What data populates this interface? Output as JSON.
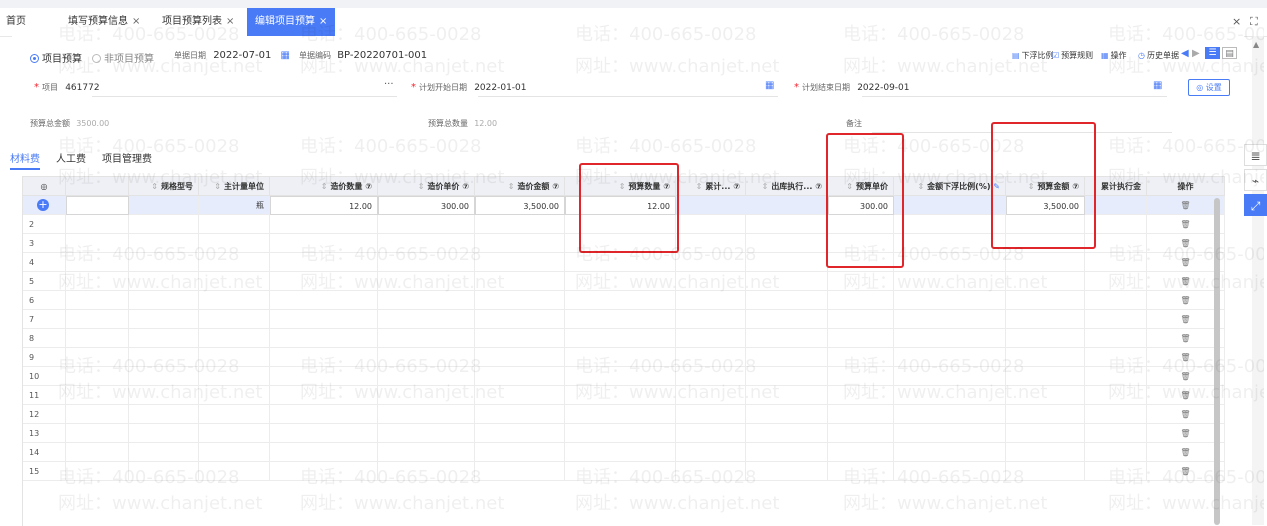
{
  "tabs": [
    {
      "label": "首页",
      "closable": false,
      "active": false
    },
    {
      "label": "填写预算信息",
      "closable": true,
      "active": false
    },
    {
      "label": "项目预算列表",
      "closable": true,
      "active": false
    },
    {
      "label": "编辑项目预算",
      "closable": true,
      "active": true
    }
  ],
  "tab_close_symbol": "×",
  "window_controls": {
    "close": "×",
    "expand": "⛶"
  },
  "header": {
    "radio_project": "项目预算",
    "radio_nonproject": "非项目预算",
    "doc_date_label": "单据日期",
    "doc_date_value": "2022-07-01",
    "doc_code_label": "单据编码",
    "doc_code_value": "BP-20220701-001"
  },
  "toolbar": [
    {
      "label": "下浮比例",
      "icon": "percent-icon"
    },
    {
      "label": "预算规则",
      "icon": "rule-icon"
    },
    {
      "label": "操作",
      "icon": "grid-icon"
    },
    {
      "label": "历史单据",
      "icon": "history-icon"
    }
  ],
  "form": {
    "project_label": "项目",
    "project_value": "461772",
    "project_more": "···",
    "start_label": "计划开始日期",
    "start_value": "2022-01-01",
    "end_label": "计划结束日期",
    "end_value": "2022-09-01",
    "settings_label": "设置",
    "total_amount_label": "预算总金额",
    "total_amount_value": "3500.00",
    "total_qty_label": "预算总数量",
    "total_qty_value": "12.00",
    "remark_label": "备注"
  },
  "subtabs": [
    "材料费",
    "人工费",
    "项目管理费"
  ],
  "grid": {
    "columns": [
      "",
      "",
      "规格型号",
      "主计量单位",
      "造价数量 ⑦",
      "造价单价 ⑦",
      "造价金额 ⑦",
      "预算数量 ⑦",
      "累计... ⑦",
      "出库执行... ⑦",
      "预算单价",
      "金额下浮比例(%)",
      "预算金额 ⑦",
      "累计执行金",
      "操作"
    ],
    "first_row": [
      "",
      "",
      "",
      "瓶",
      "12.00",
      "300.00",
      "3,500.00",
      "12.00",
      "",
      "",
      "300.00",
      "",
      "3,500.00",
      "",
      ""
    ],
    "row_numbers": [
      "2",
      "3",
      "4",
      "5",
      "6",
      "7",
      "8",
      "9",
      "10",
      "11",
      "12",
      "13",
      "14",
      "15"
    ],
    "add_symbol": "+",
    "settings_symbol": "◎",
    "trash_symbol": "🗑"
  },
  "watermark": {
    "phone": "电话：400-665-0028",
    "site": "网址：www.chanjet.net"
  },
  "colors": {
    "accent": "#4a7bf7",
    "highlight_box": "#e0262a",
    "required": "#f5222d"
  }
}
